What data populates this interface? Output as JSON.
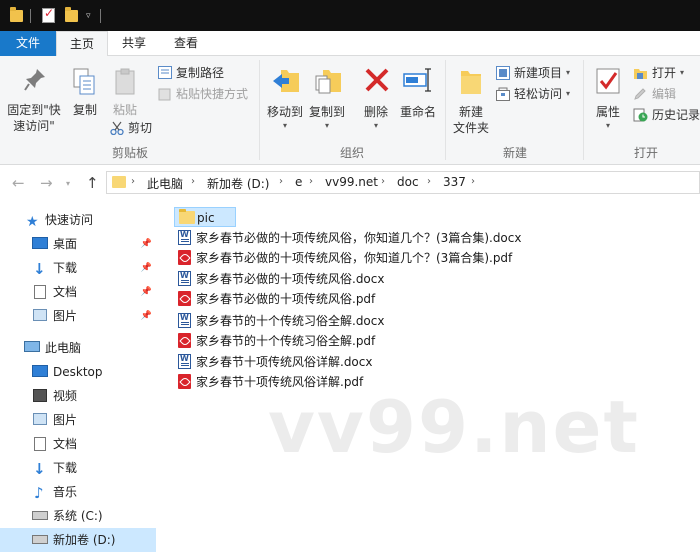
{
  "ribbon_tabs": {
    "file": "文件",
    "home": "主页",
    "share": "共享",
    "view": "查看"
  },
  "clipboard": {
    "pin_quick_access": "固定到\"快",
    "pin_quick_access_2": "速访问\"",
    "copy": "复制",
    "paste": "粘贴",
    "copy_path": "复制路径",
    "paste_shortcut": "粘贴快捷方式",
    "cut": "剪切",
    "group": "剪贴板"
  },
  "organize": {
    "move_to": "移动到",
    "copy_to": "复制到",
    "delete": "删除",
    "rename": "重命名",
    "group": "组织"
  },
  "new_group": {
    "new_folder": "新建",
    "new_folder_2": "文件夹",
    "new_item": "新建项目",
    "easy_access": "轻松访问",
    "group": "新建"
  },
  "open_group": {
    "properties": "属性",
    "open": "打开",
    "edit": "编辑",
    "history": "历史记录",
    "group": "打开"
  },
  "address": {
    "crumbs": [
      "此电脑",
      "新加卷 (D:)",
      "e",
      "vv99.net",
      "doc",
      "337"
    ]
  },
  "nav": {
    "quick_access": "快速访问",
    "qa_items": [
      "桌面",
      "下载",
      "文档",
      "图片"
    ],
    "this_pc": "此电脑",
    "pc_items": [
      "Desktop",
      "视频",
      "图片",
      "文档",
      "下载",
      "音乐",
      "系统 (C:)",
      "新加卷 (D:)"
    ]
  },
  "files": [
    {
      "name": "pic",
      "type": "folder"
    },
    {
      "name": "家乡春节必做的十项传统风俗，你知道几个？(3篇合集).docx",
      "type": "docx"
    },
    {
      "name": "家乡春节必做的十项传统风俗，你知道几个？(3篇合集).pdf",
      "type": "pdf"
    },
    {
      "name": "家乡春节必做的十项传统风俗.docx",
      "type": "docx"
    },
    {
      "name": "家乡春节必做的十项传统风俗.pdf",
      "type": "pdf"
    },
    {
      "name": "家乡春节的十个传统习俗全解.docx",
      "type": "docx"
    },
    {
      "name": "家乡春节的十个传统习俗全解.pdf",
      "type": "pdf"
    },
    {
      "name": "家乡春节十项传统风俗详解.docx",
      "type": "docx"
    },
    {
      "name": "家乡春节十项传统风俗详解.pdf",
      "type": "pdf"
    }
  ],
  "watermark": "vv99.net",
  "colors": {
    "accent": "#1979ca",
    "selection": "#cce8ff",
    "folder": "#f8d775",
    "pdf": "#d9242b",
    "word": "#2b579a"
  },
  "icons": [
    "pin-icon",
    "copy-icon",
    "paste-icon",
    "cut-icon",
    "move-to-icon",
    "copy-to-icon",
    "delete-icon",
    "rename-icon",
    "new-folder-icon",
    "properties-icon",
    "star-icon",
    "computer-icon"
  ]
}
